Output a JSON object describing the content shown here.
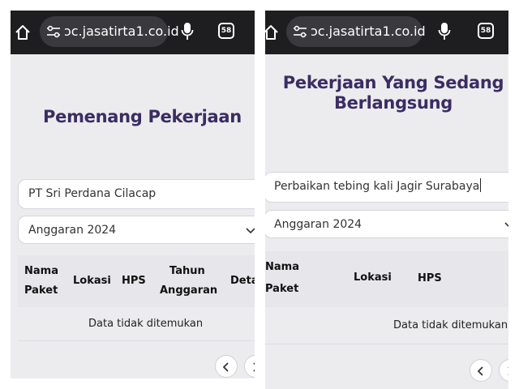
{
  "left": {
    "browser": {
      "url": "ɔc.jasatirta1.co.id",
      "tab_count": "58"
    },
    "title": "Pemenang Pekerjaan",
    "search": {
      "value": "PT Sri Perdana Cilacap"
    },
    "year_select": {
      "selected": "Anggaran 2024"
    },
    "table": {
      "headers": {
        "nama_1": "Nama",
        "nama_2": "Paket",
        "lokasi": "Lokasi",
        "hps": "HPS",
        "tahun_1": "Tahun",
        "tahun_2": "Anggaran",
        "detail": "Deta"
      },
      "empty_message": "Data tidak ditemukan"
    }
  },
  "right": {
    "browser": {
      "url": "ɔc.jasatirta1.co.id",
      "tab_count": "58"
    },
    "title_line1": "Pekerjaan Yang Sedang",
    "title_line2": "Berlangsung",
    "search": {
      "value": "Perbaikan tebing kali Jagir Surabaya"
    },
    "year_select": {
      "selected": "Anggaran 2024"
    },
    "table": {
      "headers": {
        "nama_1": "Nama",
        "nama_2": "Paket",
        "lokasi": "Lokasi",
        "hps": "HPS"
      },
      "empty_message": "Data tidak ditemukan"
    }
  },
  "colors": {
    "title": "#3b2d63",
    "url_bar": "#1e1e20",
    "url_pill": "#3a3a3e",
    "page_bg": "#ececef"
  }
}
